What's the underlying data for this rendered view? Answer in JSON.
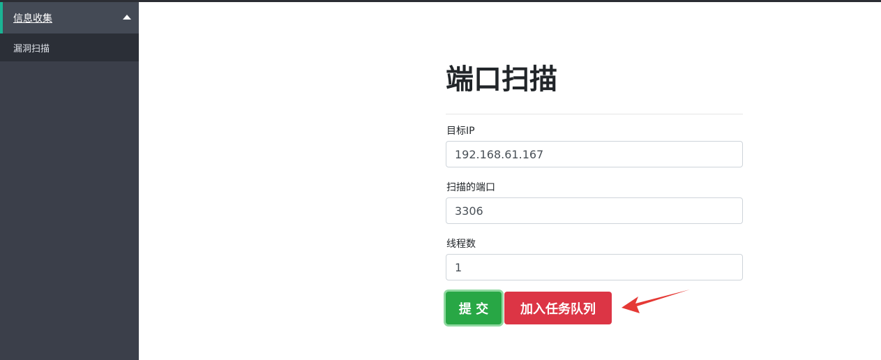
{
  "sidebar": {
    "group_label": "信息收集",
    "items": [
      {
        "label": "漏洞扫描"
      }
    ]
  },
  "page": {
    "title": "端口扫描"
  },
  "form": {
    "target_ip": {
      "label": "目标IP",
      "value": "192.168.61.167"
    },
    "ports": {
      "label": "扫描的端口",
      "value": "3306"
    },
    "threads": {
      "label": "线程数",
      "value": "1"
    }
  },
  "buttons": {
    "submit": "提 交",
    "queue": "加入任务队列"
  },
  "colors": {
    "sidebar_bg": "#3b3f4a",
    "submit": "#28a745",
    "queue": "#dc3545",
    "annotation_arrow": "#e53935"
  }
}
